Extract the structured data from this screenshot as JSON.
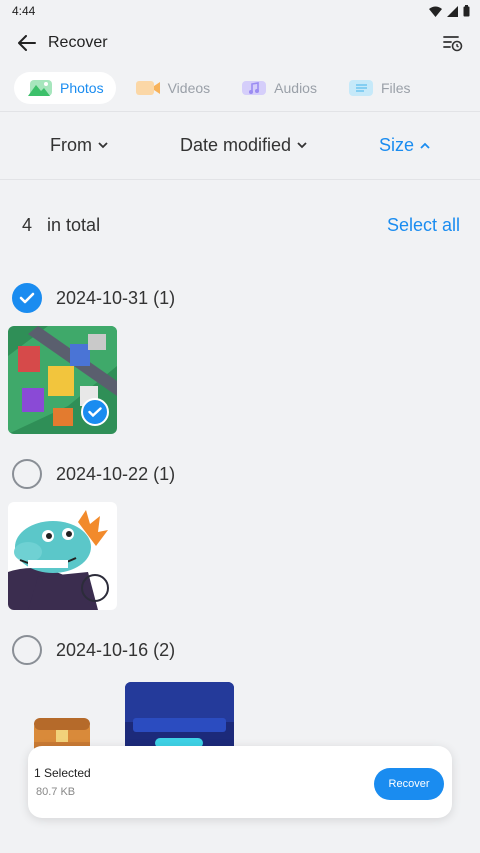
{
  "status_bar": {
    "time": "4:44"
  },
  "app_bar": {
    "title": "Recover"
  },
  "tabs": [
    {
      "label": "Photos",
      "color": "#3cc06a",
      "active": true
    },
    {
      "label": "Videos",
      "color": "#f7b25a",
      "active": false
    },
    {
      "label": "Audios",
      "color": "#9b8cf2",
      "active": false
    },
    {
      "label": "Files",
      "color": "#6ec6ef",
      "active": false
    }
  ],
  "sort": {
    "from": "From",
    "date_modified": "Date modified",
    "size": "Size"
  },
  "summary": {
    "count": "4",
    "count_suffix": "in total",
    "select_all": "Select all"
  },
  "groups": [
    {
      "date": "2024-10-31 (1)",
      "checked": true
    },
    {
      "date": "2024-10-22 (1)",
      "checked": false
    },
    {
      "date": "2024-10-16 (2)",
      "checked": false
    }
  ],
  "bottom": {
    "selected": "1 Selected",
    "size": "80.7 KB",
    "button": "Recover"
  },
  "colors": {
    "accent": "#1a8cf0",
    "background": "#f1f2f4"
  }
}
